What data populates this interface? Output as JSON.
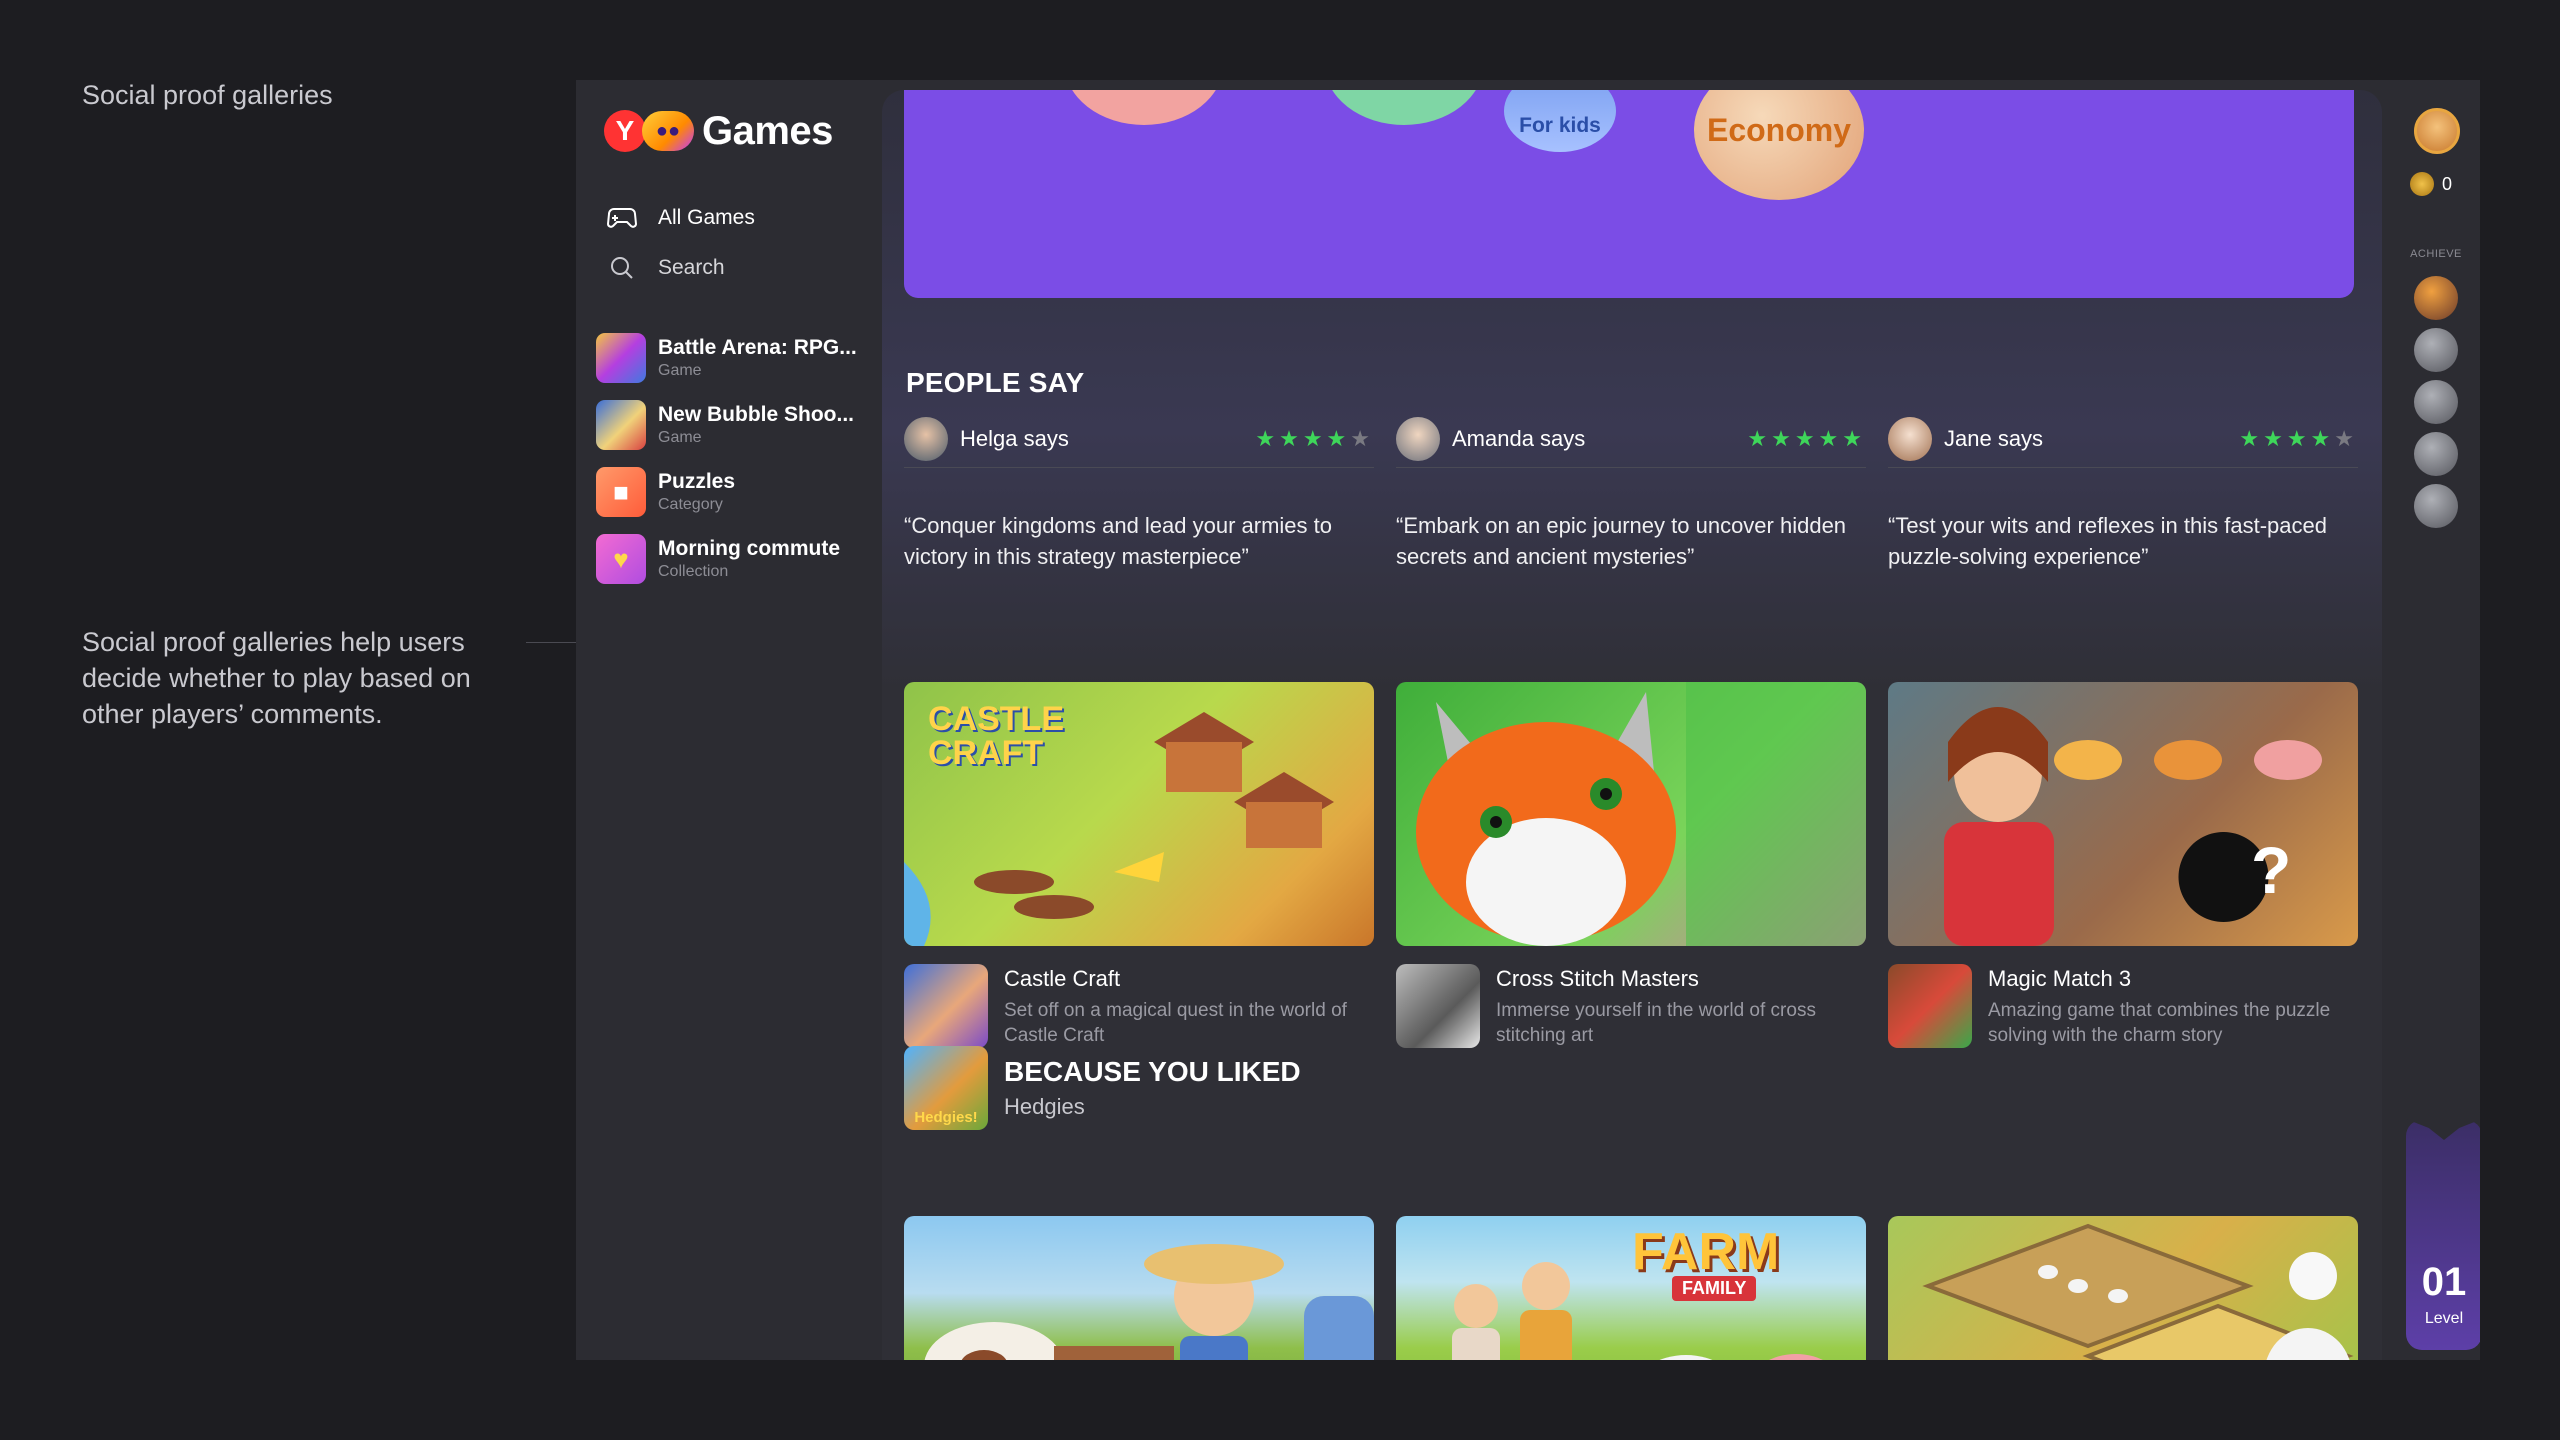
{
  "annotation": {
    "title": "Social proof galleries",
    "description": "Social proof galleries help users decide whether to play based on other players’ comments."
  },
  "app": {
    "logo_text": "Games",
    "nav": {
      "all_games": "All Games",
      "search": "Search"
    },
    "recent": [
      {
        "name": "Battle Arena: RPG...",
        "sub": "Game"
      },
      {
        "name": "New Bubble Shoo...",
        "sub": "Game"
      },
      {
        "name": "Puzzles",
        "sub": "Category"
      },
      {
        "name": "Morning commute",
        "sub": "Collection"
      }
    ]
  },
  "banner": {
    "for_kids": "For kids",
    "economy": "Economy"
  },
  "people_say": {
    "title": "PEOPLE SAY",
    "reviews": [
      {
        "name": "Helga says",
        "stars": "★★★★",
        "stars_off": "★",
        "rating": 4,
        "quote": "“Conquer kingdoms and lead your armies to victory in this strategy masterpiece”"
      },
      {
        "name": "Amanda says",
        "stars": "★★★★★",
        "stars_off": "",
        "rating": 5,
        "quote": "“Embark on an epic journey to uncover hidden secrets and ancient mysteries”"
      },
      {
        "name": "Jane says",
        "stars": "★★★★",
        "stars_off": "★",
        "rating": 4,
        "quote": "“Test your wits and reflexes in this fast-paced puzzle-solving experience”"
      }
    ],
    "games": [
      {
        "name": "Castle Craft",
        "desc": "Set off on a magical quest in the world of Castle Craft",
        "art_title": "CASTLE CRAFT"
      },
      {
        "name": "Cross Stitch Masters",
        "desc": "Immerse yourself in the world of cross stitching art",
        "art_title": ""
      },
      {
        "name": "Magic Match 3",
        "desc": "Amazing game that combines the puzzle solving with the charm story",
        "art_title": "?"
      }
    ]
  },
  "because_you_liked": {
    "title": "BECAUSE YOU LIKED",
    "subtitle": "Hedgies",
    "icon_text": "Hedgies!",
    "cards": [
      {
        "art_title": ""
      },
      {
        "art_title": "FARM",
        "art_sub": "FAMILY"
      },
      {
        "art_title": ""
      }
    ]
  },
  "rightbar": {
    "coins": "0",
    "achieve_label": "ACHIEVE",
    "level_number": "01",
    "level_label": "Level"
  },
  "colors": {
    "accent": "#7b4de6",
    "star": "#3ed65a",
    "background": "#1d1d21",
    "panel": "#2c2c32"
  }
}
